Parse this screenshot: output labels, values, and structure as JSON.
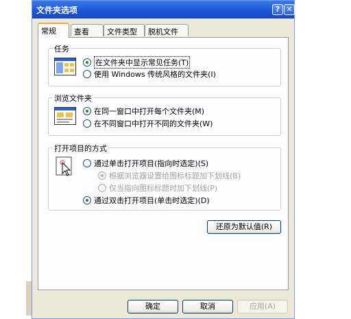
{
  "dialog": {
    "title": "文件夹选项",
    "help_glyph": "?",
    "close_glyph": "✕"
  },
  "tabs": [
    {
      "label": "常规",
      "active": true
    },
    {
      "label": "查看",
      "active": false
    },
    {
      "label": "文件类型",
      "active": false
    },
    {
      "label": "脱机文件",
      "active": false
    }
  ],
  "tasks": {
    "title": "任务",
    "option1": "在文件夹中显示常见任务(T)",
    "option2": "使用 Windows 传统风格的文件夹(I)"
  },
  "browse": {
    "title": "浏览文件夹",
    "option1": "在同一窗口中打开每个文件夹(M)",
    "option2": "在不同窗口中打开不同的文件夹(W)"
  },
  "click": {
    "title": "打开项目的方式",
    "option1": "通过单击打开项目(指向时选定)(S)",
    "sub1": "根据浏览器设置给图标标题加下划线(B)",
    "sub2": "仅当指向图标标题时加下划线(P)",
    "option2": "通过双击打开项目(单击时选定)(D)"
  },
  "restore_button": "还原为默认值(R)",
  "footer": {
    "ok": "确定",
    "cancel": "取消",
    "apply": "应用(A)"
  },
  "colors": {
    "titlebar": "#1c56d6",
    "dialog_bg": "#ece9d8",
    "tab_highlight": "#f2a937"
  }
}
